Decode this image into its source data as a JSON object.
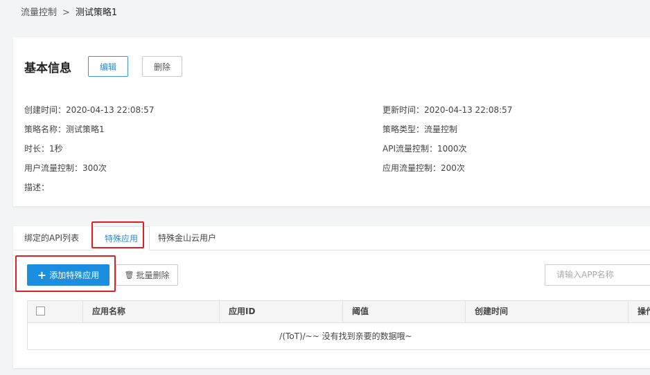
{
  "breadcrumb": {
    "parent": "流量控制",
    "separator": ">",
    "current": "测试策略1"
  },
  "info": {
    "title": "基本信息",
    "edit_label": "编辑",
    "delete_label": "删除",
    "created_at": "创建时间：2020-04-13 22:08:57",
    "updated_at": "更新时间：2020-04-13 22:08:57",
    "name": "策略名称：测试策略1",
    "type": "策略类型：流量控制",
    "duration": "时长：1秒",
    "api_limit": "API流量控制：1000次",
    "user_limit": "用户流量控制：300次",
    "app_limit": "应用流量控制：200次",
    "description": "描述："
  },
  "tabs": [
    {
      "label": "绑定的API列表"
    },
    {
      "label": "特殊应用",
      "active": true
    },
    {
      "label": "特殊金山云用户"
    }
  ],
  "toolbar": {
    "add_label": "添加特殊应用",
    "batch_delete_label": "批量删除",
    "search_placeholder": "请输入APP名称"
  },
  "table": {
    "columns": [
      "应用名称",
      "应用ID",
      "阈值",
      "创建时间",
      "操作"
    ],
    "empty_text": "/(ToT)/~~ 没有找到亲要的数据哦~"
  },
  "colors": {
    "primary": "#1b8ee0",
    "highlight": "#e02020",
    "link": "#2a8ad6"
  }
}
